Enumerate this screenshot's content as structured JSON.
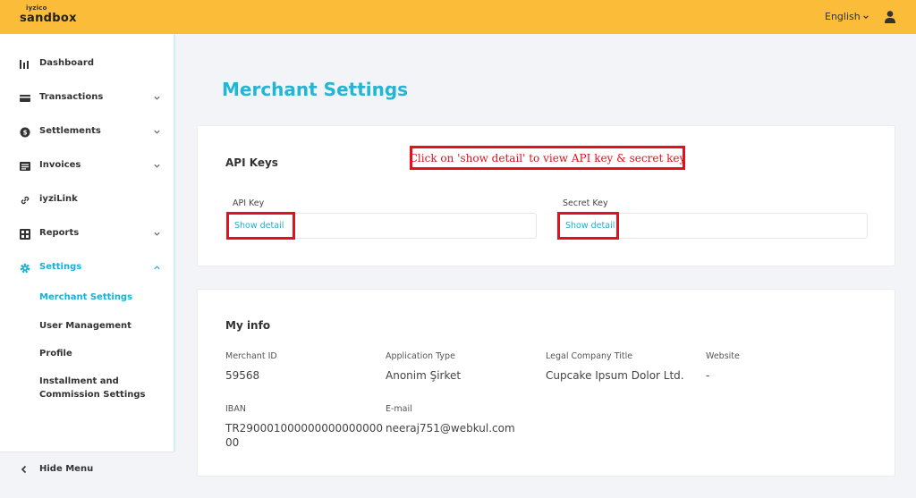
{
  "header": {
    "logo_small": "iyzico",
    "logo_big": "sandbox",
    "language": "English"
  },
  "sidebar": {
    "items": [
      {
        "label": "Dashboard",
        "icon": "bar-chart-icon"
      },
      {
        "label": "Transactions",
        "icon": "card-icon"
      },
      {
        "label": "Settlements",
        "icon": "coin-icon"
      },
      {
        "label": "Invoices",
        "icon": "list-icon"
      },
      {
        "label": "iyziLink",
        "icon": "link-icon"
      },
      {
        "label": "Reports",
        "icon": "grid-icon"
      },
      {
        "label": "Settings",
        "icon": "gear-icon"
      }
    ],
    "sub_items": [
      {
        "label": "Merchant Settings"
      },
      {
        "label": "User Management"
      },
      {
        "label": "Profile"
      },
      {
        "label": "Installment and Commission Settings"
      }
    ],
    "hide_menu": "Hide Menu"
  },
  "main": {
    "title": "Merchant Settings",
    "api_keys": {
      "title": "API Keys",
      "annotation": "Click on 'show detail' to view API key & secret key",
      "api_key_label": "API Key",
      "secret_key_label": "Secret Key",
      "show_detail": "Show detail"
    },
    "my_info": {
      "title": "My info",
      "merchant_id_label": "Merchant ID",
      "merchant_id": "59568",
      "application_type_label": "Application Type",
      "application_type": "Anonim Şirket",
      "legal_company_title_label": "Legal Company Title",
      "legal_company_title": "Cupcake Ipsum Dolor Ltd.",
      "website_label": "Website",
      "website": "-",
      "iban_label": "IBAN",
      "iban_line1": "TR290001000000000000000",
      "iban_line2": "00",
      "email_label": "E-mail",
      "email": "neeraj751@webkul.com"
    }
  },
  "colors": {
    "header_bg": "#fbbd39",
    "accent": "#1ab0d0",
    "annotation_red": "#e2111b"
  }
}
